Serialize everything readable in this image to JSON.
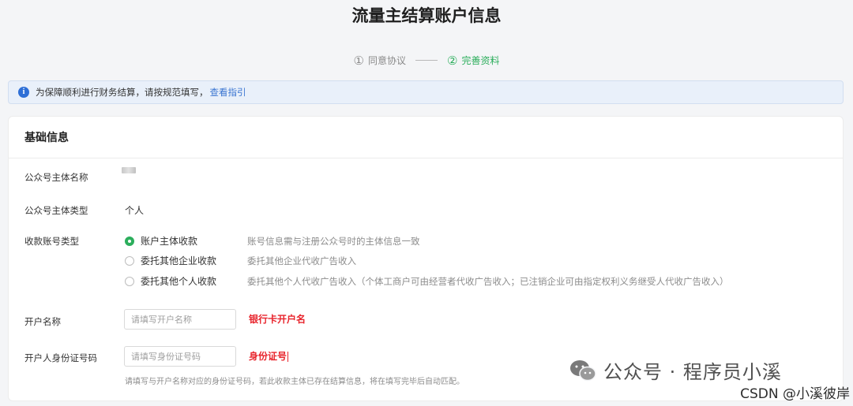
{
  "page": {
    "title": "流量主结算账户信息"
  },
  "steps": [
    {
      "number": "①",
      "label": "同意协议",
      "active": false
    },
    {
      "number": "②",
      "label": "完善资料",
      "active": true
    }
  ],
  "notice": {
    "icon": "info-icon",
    "text": "为保障顺利进行财务结算，请按规范填写，",
    "link": "查看指引"
  },
  "basic_info": {
    "section_title": "基础信息",
    "entity_name_label": "公众号主体名称",
    "entity_type_label": "公众号主体类型",
    "entity_type_value": "个人",
    "account_type_label": "收款账号类型",
    "account_types": [
      {
        "label": "账户主体收款",
        "desc": "账号信息需与注册公众号时的主体信息一致",
        "checked": true
      },
      {
        "label": "委托其他企业收款",
        "desc": "委托其他企业代收广告收入",
        "checked": false
      },
      {
        "label": "委托其他个人收款",
        "desc": "委托其他个人代收广告收入（个体工商户可由经营者代收广告收入；已注销企业可由指定权利义务继受人代收广告收入）",
        "checked": false
      }
    ],
    "account_name_label": "开户名称",
    "account_name_placeholder": "请填写开户名称",
    "account_name_annotation": "银行卡开户名",
    "id_number_label": "开户人身份证号码",
    "id_number_placeholder": "请填写身份证号码",
    "id_number_annotation": "身份证号",
    "id_hint": "请填写与开户名称对应的身份证号码，若此收款主体已存在结算信息，将在填写完毕后自动匹配。"
  },
  "watermark": {
    "text": "公众号 · 程序员小溪",
    "credit": "CSDN @小溪彼岸"
  },
  "colors": {
    "accent_green": "#2cae5c",
    "link_blue": "#3a75d1",
    "annotation_red": "#e8242c"
  }
}
